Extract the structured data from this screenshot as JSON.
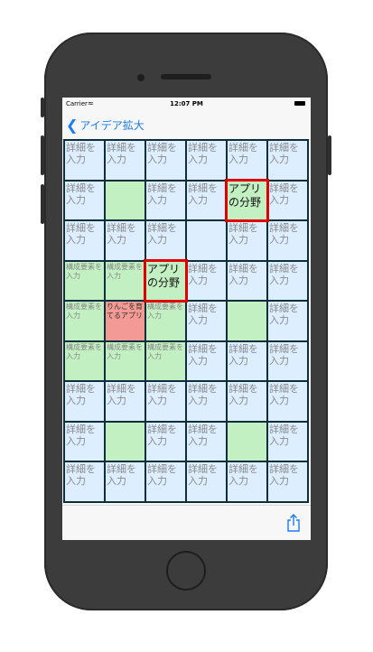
{
  "status_bar": {
    "carrier": "Carrier",
    "time": "12:07 PM"
  },
  "nav": {
    "back_label": "アイデア拡大"
  },
  "grid": {
    "rows": [
      [
        {
          "text": "詳細を入力",
          "style": "blue"
        },
        {
          "text": "詳細を入力",
          "style": "blue"
        },
        {
          "text": "詳細を入力",
          "style": "blue"
        },
        {
          "text": "詳細を入力",
          "style": "blue"
        },
        {
          "text": "詳細を入力",
          "style": "blue"
        },
        {
          "text": "詳細を入力",
          "style": "blue"
        }
      ],
      [
        {
          "text": "詳細を入力",
          "style": "blue"
        },
        {
          "text": "",
          "style": "green"
        },
        {
          "text": "詳細を入力",
          "style": "blue"
        },
        {
          "text": "詳細を入力",
          "style": "blue"
        },
        {
          "text": "アプリの分野",
          "style": "focus"
        },
        {
          "text": "詳細を入力",
          "style": "blue"
        }
      ],
      [
        {
          "text": "詳細を入力",
          "style": "blue"
        },
        {
          "text": "詳細を入力",
          "style": "blue"
        },
        {
          "text": "詳細を入力",
          "style": "blue"
        },
        {
          "text": "",
          "style": "blue"
        },
        {
          "text": "詳細を入力",
          "style": "blue"
        },
        {
          "text": "詳細を入力",
          "style": "blue"
        }
      ],
      [
        {
          "text": "構成要素を入力",
          "style": "green-small"
        },
        {
          "text": "構成要素を入力",
          "style": "green-small"
        },
        {
          "text": "アプリの分野",
          "style": "focus"
        },
        {
          "text": "詳細を入力",
          "style": "blue"
        },
        {
          "text": "詳細を入力",
          "style": "blue"
        },
        {
          "text": "詳細を入力",
          "style": "blue"
        }
      ],
      [
        {
          "text": "構成要素を入力",
          "style": "green-small"
        },
        {
          "text": "りんごを育てるアプリ",
          "style": "red"
        },
        {
          "text": "構成要素を入力",
          "style": "green-small"
        },
        {
          "text": "詳細を入力",
          "style": "blue"
        },
        {
          "text": "",
          "style": "green"
        },
        {
          "text": "詳細を入力",
          "style": "blue"
        }
      ],
      [
        {
          "text": "構成要素を入力",
          "style": "green-small"
        },
        {
          "text": "構成要素を入力",
          "style": "green-small"
        },
        {
          "text": "構成要素を入力",
          "style": "green-small"
        },
        {
          "text": "詳細を入力",
          "style": "blue"
        },
        {
          "text": "詳細を入力",
          "style": "blue"
        },
        {
          "text": "詳細を入力",
          "style": "blue"
        }
      ],
      [
        {
          "text": "詳細を入力",
          "style": "blue"
        },
        {
          "text": "詳細を入力",
          "style": "blue"
        },
        {
          "text": "詳細を入力",
          "style": "blue"
        },
        {
          "text": "詳細を入力",
          "style": "blue"
        },
        {
          "text": "詳細を入力",
          "style": "blue"
        },
        {
          "text": "詳細を入力",
          "style": "blue"
        }
      ],
      [
        {
          "text": "詳細を入力",
          "style": "blue"
        },
        {
          "text": "",
          "style": "green"
        },
        {
          "text": "詳細を入力",
          "style": "blue"
        },
        {
          "text": "詳細を入力",
          "style": "blue"
        },
        {
          "text": "",
          "style": "green"
        },
        {
          "text": "詳細を入力",
          "style": "blue"
        }
      ],
      [
        {
          "text": "詳細を入力",
          "style": "blue"
        },
        {
          "text": "詳細を入力",
          "style": "blue"
        },
        {
          "text": "詳細を入力",
          "style": "blue"
        },
        {
          "text": "詳細を入力",
          "style": "blue"
        },
        {
          "text": "詳細を入力",
          "style": "blue"
        },
        {
          "text": "詳細を入力",
          "style": "blue"
        }
      ]
    ]
  },
  "toolbar": {
    "share_icon": "share-icon"
  },
  "colors": {
    "accent": "#1a7cf5",
    "grid_line": "#0f2e3c",
    "cell_blue": "#dceeff",
    "cell_green": "#c3f0c2",
    "cell_red": "#f49a95",
    "focus_border": "#e00000"
  }
}
